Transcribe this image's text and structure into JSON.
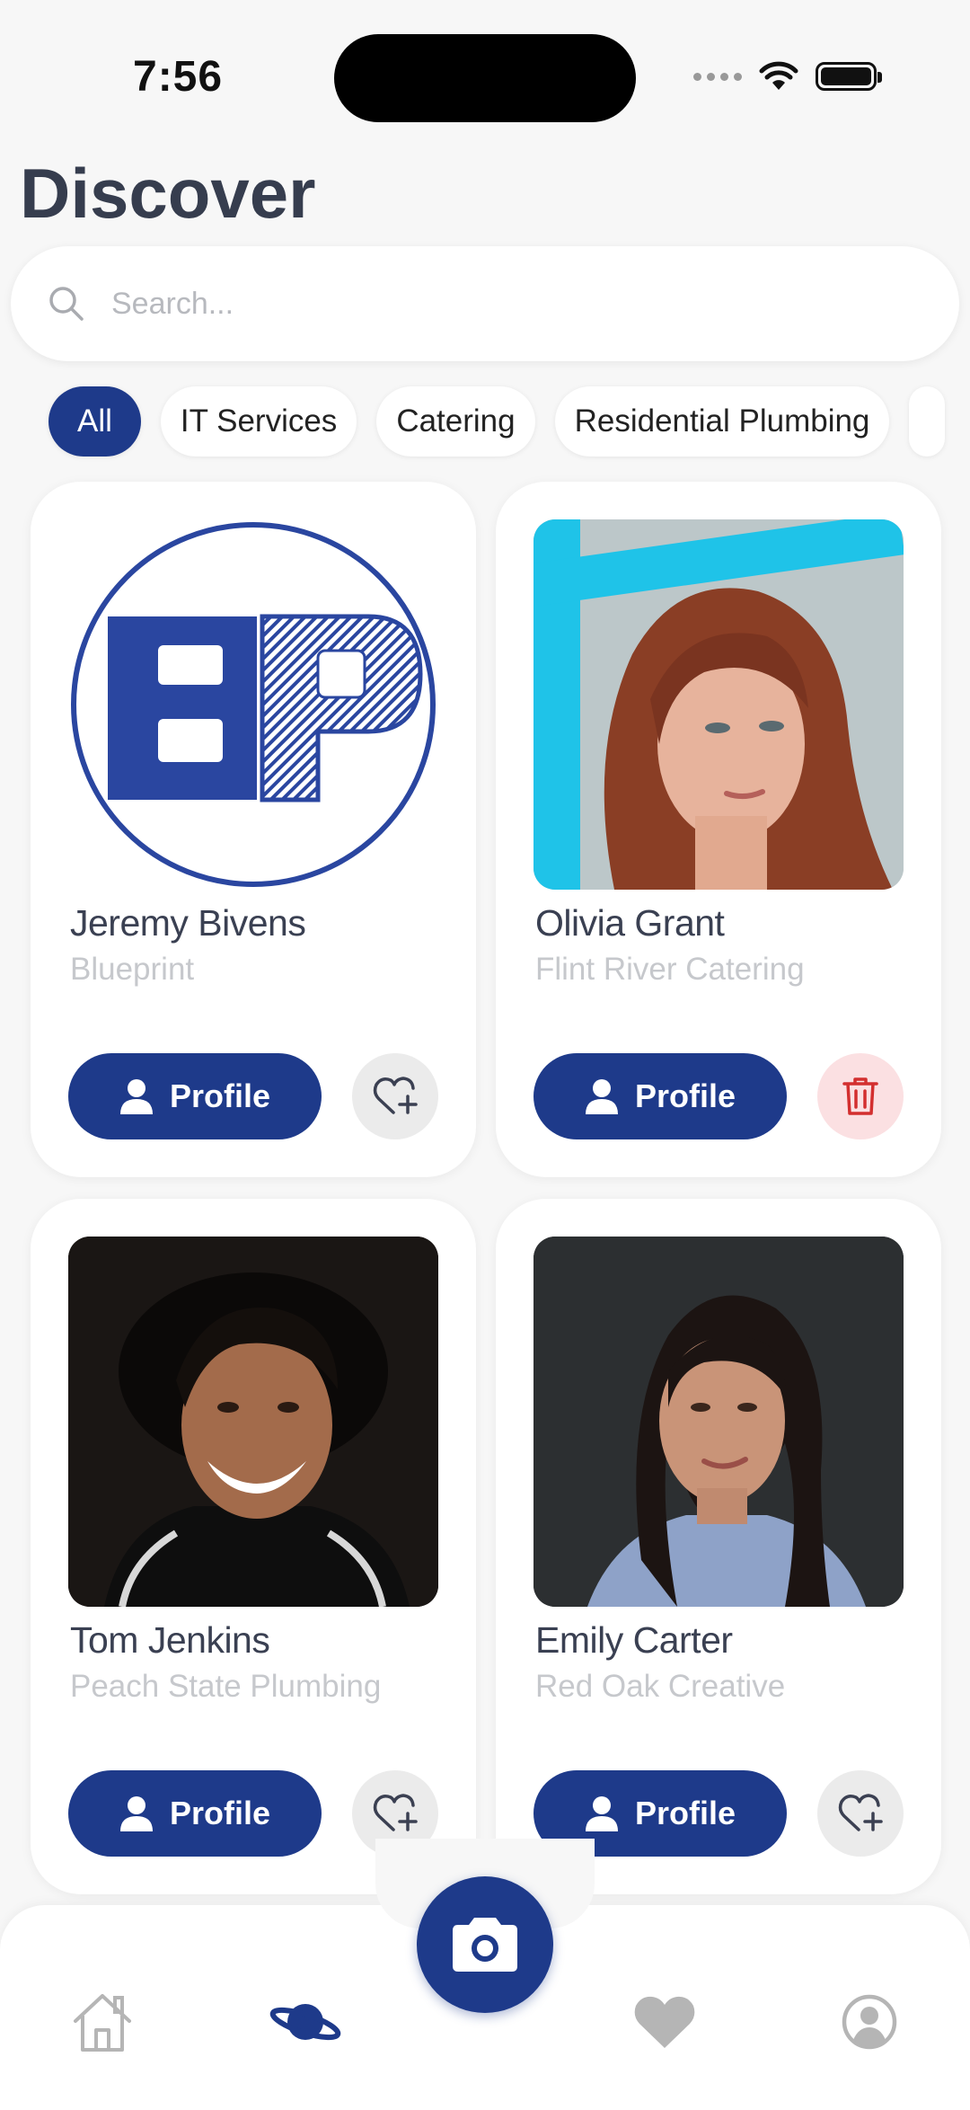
{
  "status": {
    "time": "7:56"
  },
  "header": {
    "title": "Discover"
  },
  "search": {
    "placeholder": "Search...",
    "value": ""
  },
  "filters": [
    {
      "label": "All",
      "active": true
    },
    {
      "label": "IT Services",
      "active": false
    },
    {
      "label": "Catering",
      "active": false
    },
    {
      "label": "Residential Plumbing",
      "active": false
    }
  ],
  "cards": [
    {
      "name": "Jeremy Bivens",
      "company": "Blueprint",
      "profile_label": "Profile",
      "action": "favorite-add",
      "image": "blueprint-logo"
    },
    {
      "name": "Olivia Grant",
      "company": "Flint River Catering",
      "profile_label": "Profile",
      "action": "delete",
      "image": "portrait-woman-red-hair"
    },
    {
      "name": "Tom Jenkins",
      "company": "Peach State Plumbing",
      "profile_label": "Profile",
      "action": "favorite-add",
      "image": "portrait-man-smiling-hat"
    },
    {
      "name": "Emily Carter",
      "company": "Red Oak Creative",
      "profile_label": "Profile",
      "action": "favorite-add",
      "image": "portrait-woman-dark-hair"
    }
  ],
  "nav": {
    "items": [
      "home-icon",
      "discover-planet-icon",
      "camera-icon",
      "heart-icon",
      "account-icon"
    ],
    "active": "discover-planet-icon"
  },
  "colors": {
    "primary": "#1e3a8a",
    "background": "#f7f7f7",
    "delete_bg": "#fbe0e2",
    "delete_icon": "#d32f2f",
    "muted": "#c6c8cc"
  }
}
